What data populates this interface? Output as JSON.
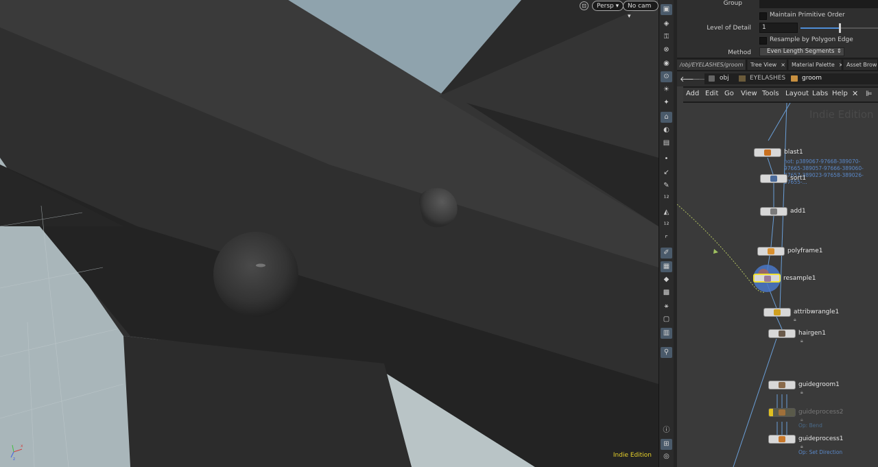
{
  "viewport": {
    "view_mode": "Persp",
    "camera": "No cam",
    "edition_label": "Indie Edition"
  },
  "params": {
    "group_label": "Group",
    "group_value": "",
    "maintain_primitive_order": "Maintain Primitive Order",
    "level_of_detail_label": "Level of Detail",
    "level_of_detail_value": "1",
    "level_of_detail_fraction": 0.5,
    "resample_by_polygon_edge": "Resample by Polygon Edge",
    "method_label": "Method",
    "method_value": "Even Length Segments"
  },
  "tabs": [
    {
      "label": "/obj/EYELASHES/groom"
    },
    {
      "label": "Tree View"
    },
    {
      "label": "Material Palette"
    },
    {
      "label": "Asset Browse"
    }
  ],
  "tab_close": "×",
  "path": {
    "obj": "obj",
    "eyelashes": "EYELASHES",
    "groom": "groom"
  },
  "menu": [
    "Add",
    "Edit",
    "Go",
    "View",
    "Tools",
    "Layout",
    "Labs",
    "Help"
  ],
  "network": {
    "watermark": "Indie Edition",
    "blast_note": "not: p389067-97668-389070-97665-389057-97666-389060-97657-389023-97658-389026-97655-...",
    "nodes": [
      {
        "label": "blast1",
        "icon_color": "#c87020"
      },
      {
        "label": "sort1",
        "icon_color": "#4a6a9a"
      },
      {
        "label": "add1",
        "icon_color": "#7a7a7a"
      },
      {
        "label": "polyframe1",
        "icon_color": "#d89030"
      },
      {
        "label": "resample1",
        "icon_color": "#9a7a9a"
      },
      {
        "label": "attribwrangle1",
        "icon_color": "#d0a020"
      },
      {
        "label": "hairgen1",
        "icon_color": "#6a5a4a"
      },
      {
        "label": "guidegroom1",
        "icon_color": "#8a6a4a"
      },
      {
        "label": "guideprocess2",
        "icon_color": "#a0703a",
        "sub": "Op: Bend"
      },
      {
        "label": "guideprocess1",
        "icon_color": "#c8782a",
        "sub": "Op: Set Direction"
      }
    ]
  },
  "colors": {
    "selected_outline": "#f0e030",
    "wire": "#6a9fd8",
    "edition": "#e8d22a"
  }
}
